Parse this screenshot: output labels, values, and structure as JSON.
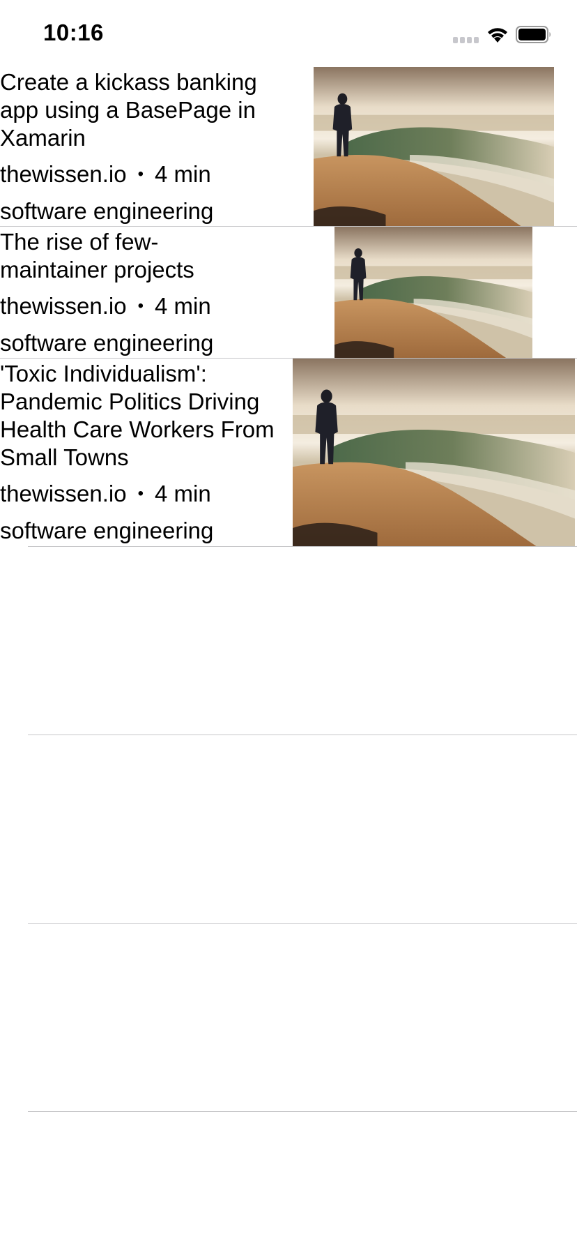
{
  "status_bar": {
    "time": "10:16",
    "signal_icon": "cellular-signal-icon",
    "wifi_icon": "wifi-icon",
    "battery_icon": "battery-icon"
  },
  "articles": [
    {
      "title": "Create a kickass banking app using a BasePage in Xamarin",
      "source": "thewissen.io",
      "separator": "•",
      "read_time": "4 min",
      "category": "software engineering",
      "thumbnail_icon": "man-at-seashore-photo"
    },
    {
      "title": "The rise of few-maintainer projects",
      "source": "thewissen.io",
      "separator": "•",
      "read_time": "4 min",
      "category": "software engineering",
      "thumbnail_icon": "man-at-seashore-photo"
    },
    {
      "title": "'Toxic Individualism': Pandemic Politics Driving Health Care Workers From Small Towns",
      "source": "thewissen.io",
      "separator": "•",
      "read_time": "4 min",
      "category": "software engineering",
      "thumbnail_icon": "man-at-seashore-photo"
    }
  ],
  "colors": {
    "separator": "#c6c6c8",
    "text": "#000000",
    "background": "#ffffff"
  }
}
